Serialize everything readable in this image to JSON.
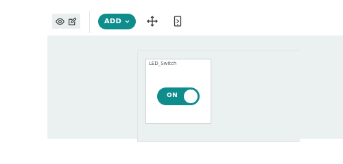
{
  "toolbar": {
    "mode_icons": [
      "eye-icon",
      "edit-icon"
    ],
    "add_label": "ADD",
    "add_icon": "chevron-down-icon",
    "move_icon": "move-arrows-icon",
    "device_icon": "mobile-device-icon"
  },
  "widget": {
    "title": "LED_Switch",
    "toggle_label": "ON",
    "toggle_on": true
  },
  "colors": {
    "accent": "#0f8c8c",
    "canvas": "#ebf0f0",
    "toolbar_group": "#e9eeee"
  }
}
